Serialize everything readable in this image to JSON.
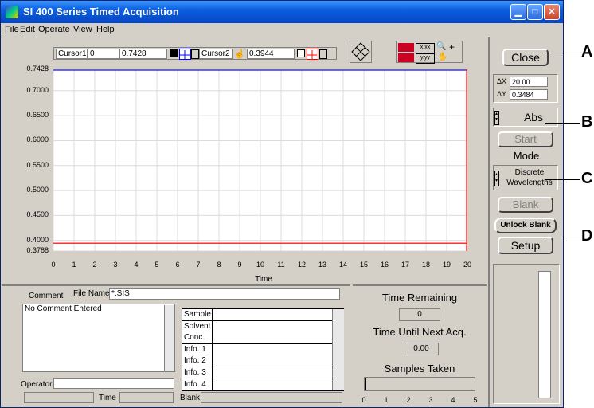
{
  "window": {
    "title": "SI 400 Series Timed Acquisition"
  },
  "menu": [
    "File",
    "Edit",
    "Operate",
    "View",
    "Help"
  ],
  "cursors": {
    "cursor1_label": "Cursor1",
    "cursor1_x": "0",
    "cursor1_y": "0.7428",
    "cursor2_label": "Cursor2",
    "cursor2_y": "0.3944"
  },
  "graph": {
    "xlabel": "Time",
    "yticks": [
      "0.7428",
      "0.7000",
      "0.6500",
      "0.6000",
      "0.5500",
      "0.5000",
      "0.4500",
      "0.4000",
      "0.3788"
    ],
    "yvalues": [
      0.7428,
      0.7,
      0.65,
      0.6,
      0.55,
      0.5,
      0.45,
      0.4,
      0.3788
    ],
    "ylim": [
      0.3788,
      0.7428
    ],
    "xticks": [
      "0",
      "1",
      "2",
      "3",
      "4",
      "5",
      "6",
      "7",
      "8",
      "9",
      "10",
      "11",
      "12",
      "13",
      "14",
      "15",
      "16",
      "17",
      "18",
      "19",
      "20"
    ],
    "xlim": [
      0,
      20
    ],
    "cursor1_value": 0.7428,
    "cursor2_value": 0.3944,
    "grid_color": "#dcdcdc",
    "cursor1_color": "#3333ff",
    "cursor2_color": "#ff3333"
  },
  "right": {
    "close_label": "Close",
    "dx_label": "ΔX",
    "dx_value": "20.00",
    "dy_label": "ΔY",
    "dy_value": "0.3484",
    "abs_label": "Abs",
    "start_label": "Start",
    "mode_label": "Mode",
    "mode_value_1": "Discrete",
    "mode_value_2": "Wavelengths",
    "blank_label": "Blank",
    "unlock_blank_label": "Unlock Blank",
    "setup_label": "Setup"
  },
  "callouts": [
    "A",
    "B",
    "C",
    "D"
  ],
  "bottom": {
    "comment_label": "Comment",
    "filename_label": "File Name",
    "filename_value": "*.SIS",
    "comment_text": "No Comment Entered",
    "operator_label": "Operator",
    "time_label": "Time",
    "blank_label": "Blank",
    "rows": [
      "Sample",
      "Solvent",
      "Conc.",
      "Info. 1",
      "Info. 2",
      "Info. 3",
      "Info. 4"
    ]
  },
  "status": {
    "time_remaining_label": "Time Remaining",
    "time_remaining_value": "0",
    "next_acq_label": "Time Until Next Acq.",
    "next_acq_value": "0.00",
    "samples_label": "Samples Taken",
    "samples_ticks": [
      "0",
      "1",
      "2",
      "3",
      "4",
      "5"
    ],
    "samples_value": 0
  }
}
